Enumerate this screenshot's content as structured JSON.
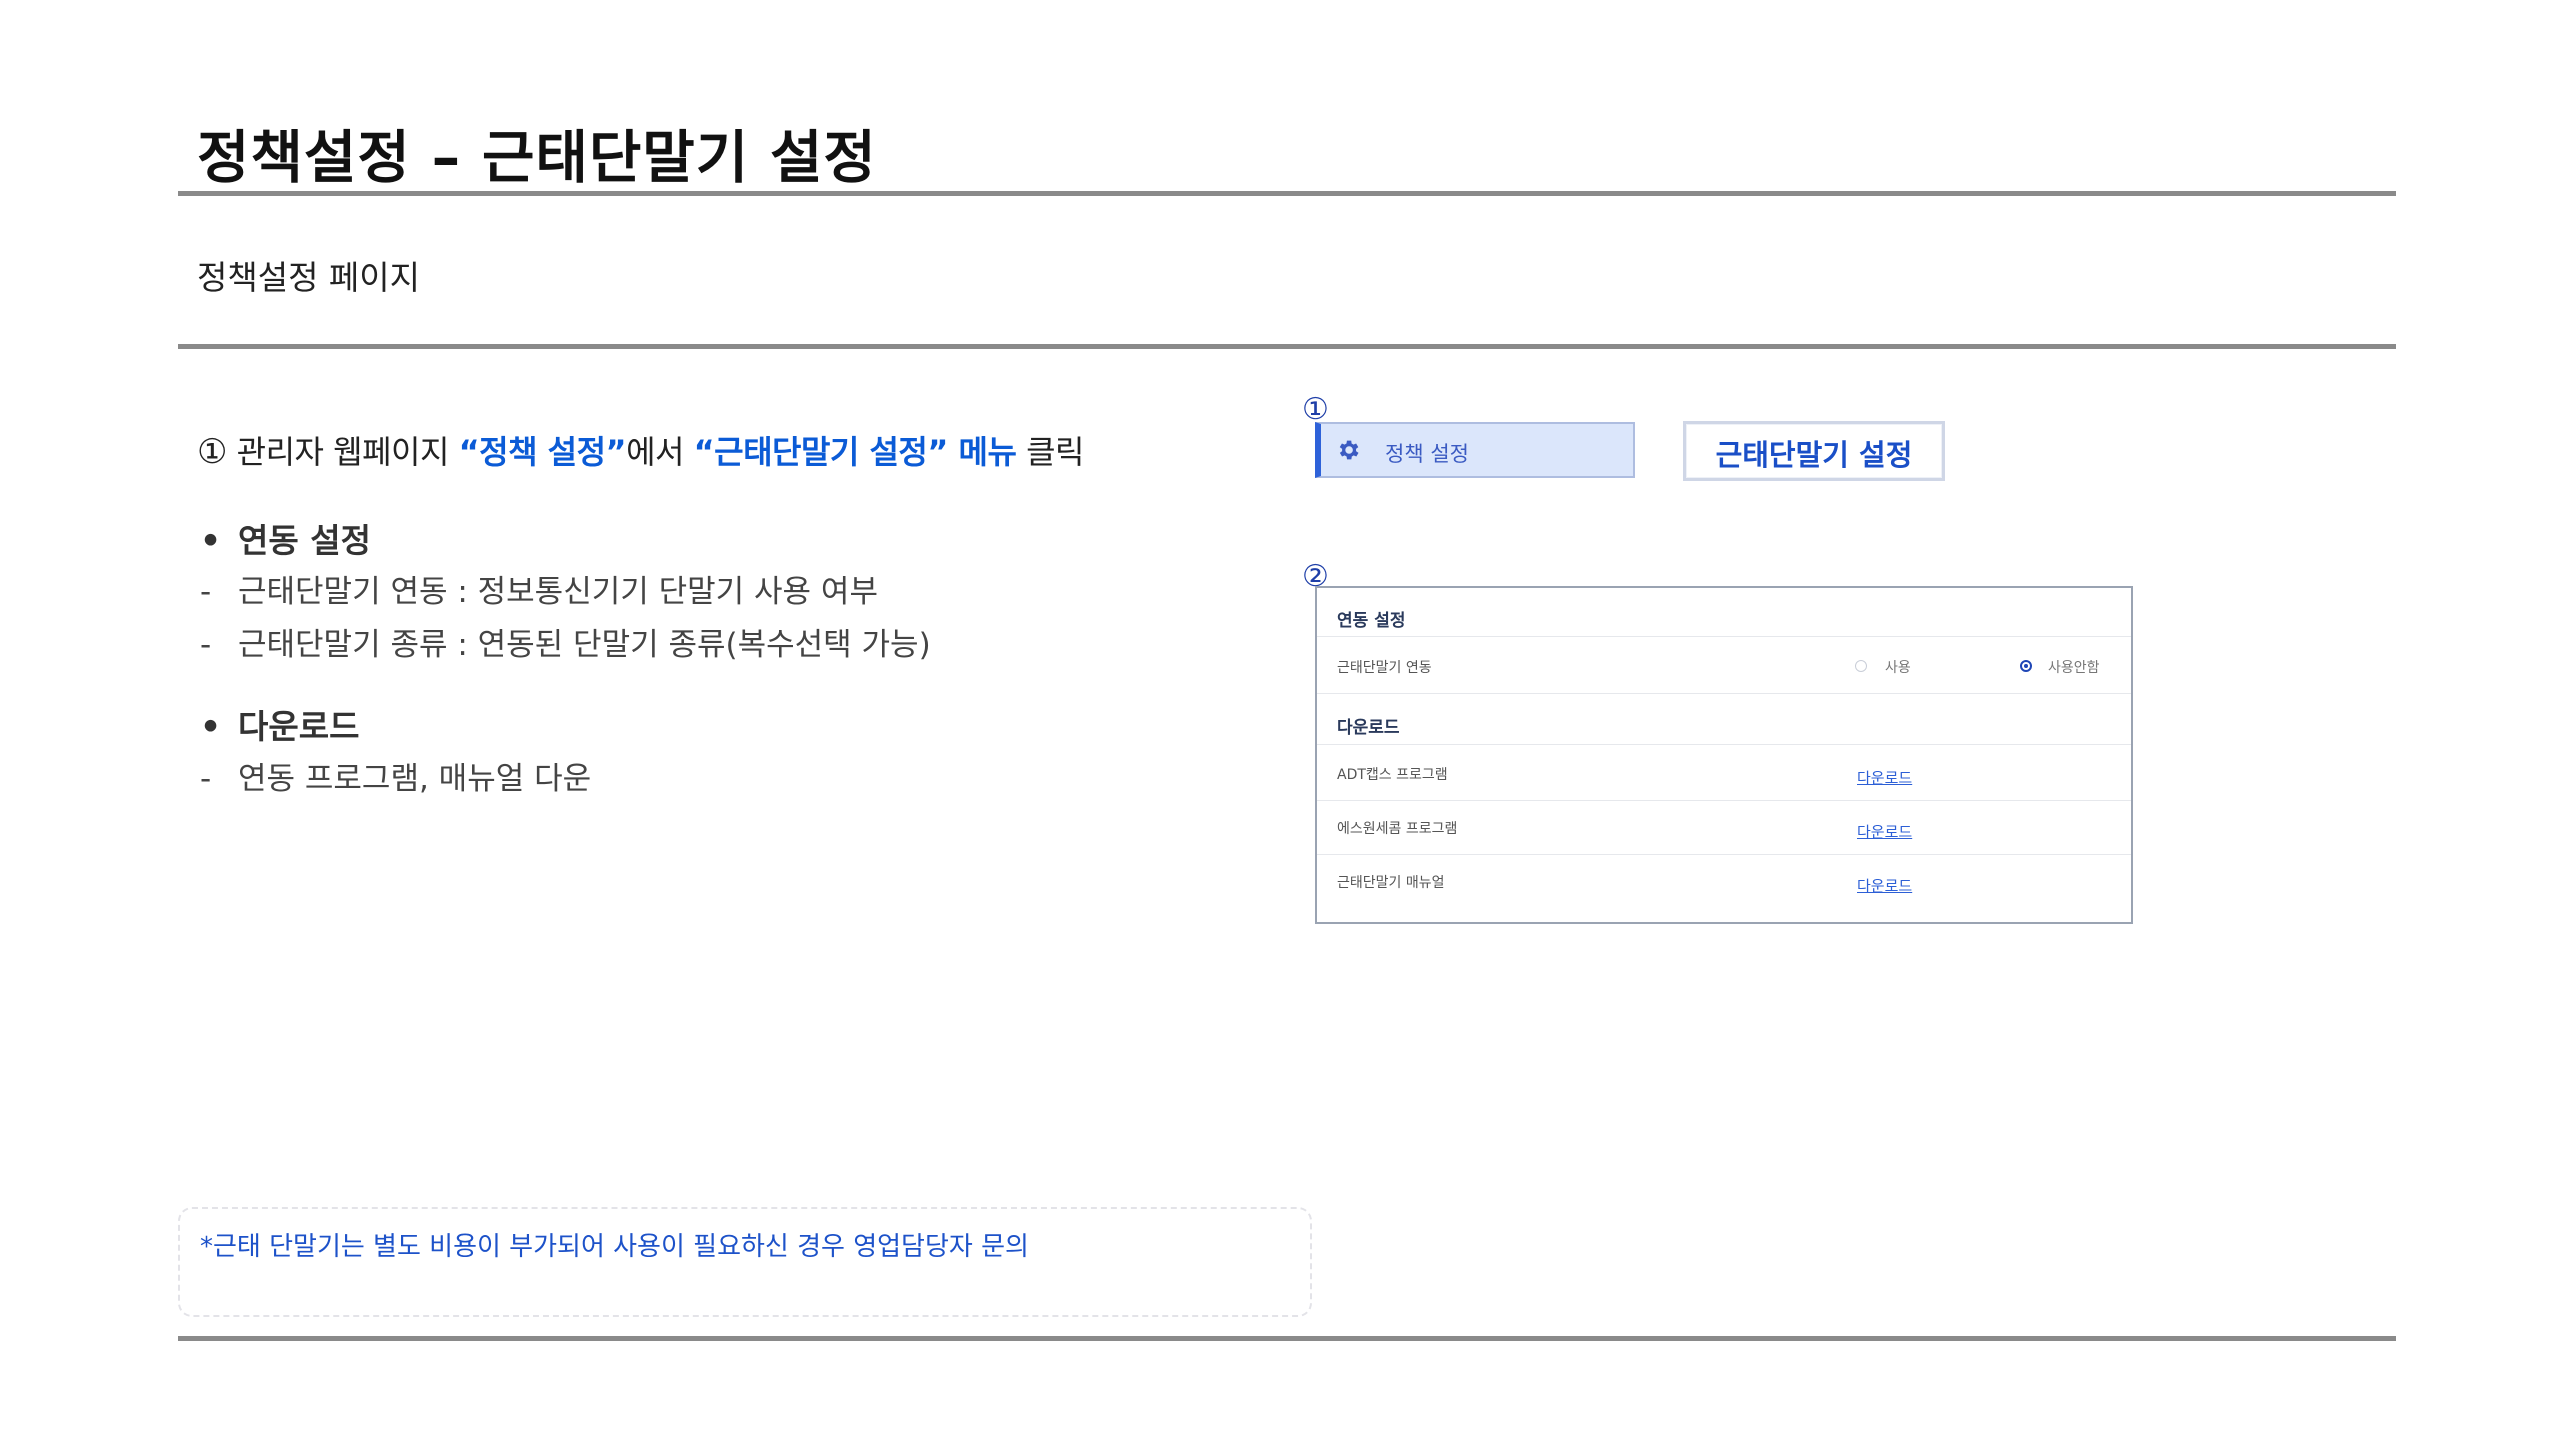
{
  "header": {
    "title": "정책설정 – 근태단말기 설정",
    "subtitle": "정책설정 페이지"
  },
  "instruction": {
    "marker": "①",
    "part1": " 관리자 웹페이지 ",
    "menu1": "“정책 설정”",
    "part2": "에서 ",
    "menu2": "“근태단말기 설정” 메뉴",
    "part3": " 클릭"
  },
  "sections": [
    {
      "bullet": "•",
      "heading": "연동 설정",
      "items": [
        "근태단말기 연동 : 정보통신기기 단말기 사용 여부",
        "근태단말기 종류 : 연동된 단말기 종류(복수선택 가능)"
      ]
    },
    {
      "bullet": "•",
      "heading": "다운로드",
      "items": [
        "연동 프로그램, 매뉴얼 다운"
      ]
    }
  ],
  "dash": "-",
  "note": "*근태 단말기는 별도 비용이 부가되어 사용이 필요하신 경우 영업담당자 문의",
  "step1": {
    "number": "①",
    "menu_label": "정책 설정",
    "menu_icon": "gear-icon",
    "button_label": "근태단말기 설정"
  },
  "step2": {
    "number": "②",
    "section1_title": "연동 설정",
    "row_label": "근태단말기 연동",
    "options": [
      {
        "label": "사용",
        "selected": false
      },
      {
        "label": "사용안함",
        "selected": true
      }
    ],
    "section2_title": "다운로드",
    "downloads": [
      {
        "name": "ADT캡스 프로그램",
        "link": "다운로드"
      },
      {
        "name": "에스원세콤 프로그램",
        "link": "다운로드"
      },
      {
        "name": "근태단말기 매뉴얼",
        "link": "다운로드"
      }
    ]
  },
  "colors": {
    "accent": "#0b5bd6",
    "rule": "#8a8a8a",
    "menu_bg": "#dbe6fb",
    "note_text": "#1d52c9"
  }
}
